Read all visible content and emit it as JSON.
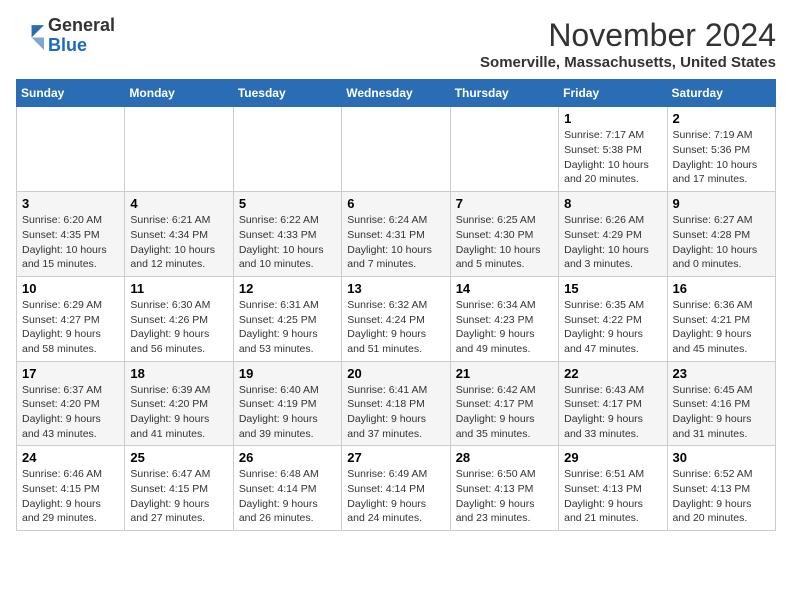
{
  "logo": {
    "general": "General",
    "blue": "Blue"
  },
  "header": {
    "month_title": "November 2024",
    "location": "Somerville, Massachusetts, United States"
  },
  "days_of_week": [
    "Sunday",
    "Monday",
    "Tuesday",
    "Wednesday",
    "Thursday",
    "Friday",
    "Saturday"
  ],
  "weeks": [
    [
      {
        "day": "",
        "info": ""
      },
      {
        "day": "",
        "info": ""
      },
      {
        "day": "",
        "info": ""
      },
      {
        "day": "",
        "info": ""
      },
      {
        "day": "",
        "info": ""
      },
      {
        "day": "1",
        "info": "Sunrise: 7:17 AM\nSunset: 5:38 PM\nDaylight: 10 hours\nand 20 minutes."
      },
      {
        "day": "2",
        "info": "Sunrise: 7:19 AM\nSunset: 5:36 PM\nDaylight: 10 hours\nand 17 minutes."
      }
    ],
    [
      {
        "day": "3",
        "info": "Sunrise: 6:20 AM\nSunset: 4:35 PM\nDaylight: 10 hours\nand 15 minutes."
      },
      {
        "day": "4",
        "info": "Sunrise: 6:21 AM\nSunset: 4:34 PM\nDaylight: 10 hours\nand 12 minutes."
      },
      {
        "day": "5",
        "info": "Sunrise: 6:22 AM\nSunset: 4:33 PM\nDaylight: 10 hours\nand 10 minutes."
      },
      {
        "day": "6",
        "info": "Sunrise: 6:24 AM\nSunset: 4:31 PM\nDaylight: 10 hours\nand 7 minutes."
      },
      {
        "day": "7",
        "info": "Sunrise: 6:25 AM\nSunset: 4:30 PM\nDaylight: 10 hours\nand 5 minutes."
      },
      {
        "day": "8",
        "info": "Sunrise: 6:26 AM\nSunset: 4:29 PM\nDaylight: 10 hours\nand 3 minutes."
      },
      {
        "day": "9",
        "info": "Sunrise: 6:27 AM\nSunset: 4:28 PM\nDaylight: 10 hours\nand 0 minutes."
      }
    ],
    [
      {
        "day": "10",
        "info": "Sunrise: 6:29 AM\nSunset: 4:27 PM\nDaylight: 9 hours\nand 58 minutes."
      },
      {
        "day": "11",
        "info": "Sunrise: 6:30 AM\nSunset: 4:26 PM\nDaylight: 9 hours\nand 56 minutes."
      },
      {
        "day": "12",
        "info": "Sunrise: 6:31 AM\nSunset: 4:25 PM\nDaylight: 9 hours\nand 53 minutes."
      },
      {
        "day": "13",
        "info": "Sunrise: 6:32 AM\nSunset: 4:24 PM\nDaylight: 9 hours\nand 51 minutes."
      },
      {
        "day": "14",
        "info": "Sunrise: 6:34 AM\nSunset: 4:23 PM\nDaylight: 9 hours\nand 49 minutes."
      },
      {
        "day": "15",
        "info": "Sunrise: 6:35 AM\nSunset: 4:22 PM\nDaylight: 9 hours\nand 47 minutes."
      },
      {
        "day": "16",
        "info": "Sunrise: 6:36 AM\nSunset: 4:21 PM\nDaylight: 9 hours\nand 45 minutes."
      }
    ],
    [
      {
        "day": "17",
        "info": "Sunrise: 6:37 AM\nSunset: 4:20 PM\nDaylight: 9 hours\nand 43 minutes."
      },
      {
        "day": "18",
        "info": "Sunrise: 6:39 AM\nSunset: 4:20 PM\nDaylight: 9 hours\nand 41 minutes."
      },
      {
        "day": "19",
        "info": "Sunrise: 6:40 AM\nSunset: 4:19 PM\nDaylight: 9 hours\nand 39 minutes."
      },
      {
        "day": "20",
        "info": "Sunrise: 6:41 AM\nSunset: 4:18 PM\nDaylight: 9 hours\nand 37 minutes."
      },
      {
        "day": "21",
        "info": "Sunrise: 6:42 AM\nSunset: 4:17 PM\nDaylight: 9 hours\nand 35 minutes."
      },
      {
        "day": "22",
        "info": "Sunrise: 6:43 AM\nSunset: 4:17 PM\nDaylight: 9 hours\nand 33 minutes."
      },
      {
        "day": "23",
        "info": "Sunrise: 6:45 AM\nSunset: 4:16 PM\nDaylight: 9 hours\nand 31 minutes."
      }
    ],
    [
      {
        "day": "24",
        "info": "Sunrise: 6:46 AM\nSunset: 4:15 PM\nDaylight: 9 hours\nand 29 minutes."
      },
      {
        "day": "25",
        "info": "Sunrise: 6:47 AM\nSunset: 4:15 PM\nDaylight: 9 hours\nand 27 minutes."
      },
      {
        "day": "26",
        "info": "Sunrise: 6:48 AM\nSunset: 4:14 PM\nDaylight: 9 hours\nand 26 minutes."
      },
      {
        "day": "27",
        "info": "Sunrise: 6:49 AM\nSunset: 4:14 PM\nDaylight: 9 hours\nand 24 minutes."
      },
      {
        "day": "28",
        "info": "Sunrise: 6:50 AM\nSunset: 4:13 PM\nDaylight: 9 hours\nand 23 minutes."
      },
      {
        "day": "29",
        "info": "Sunrise: 6:51 AM\nSunset: 4:13 PM\nDaylight: 9 hours\nand 21 minutes."
      },
      {
        "day": "30",
        "info": "Sunrise: 6:52 AM\nSunset: 4:13 PM\nDaylight: 9 hours\nand 20 minutes."
      }
    ]
  ]
}
